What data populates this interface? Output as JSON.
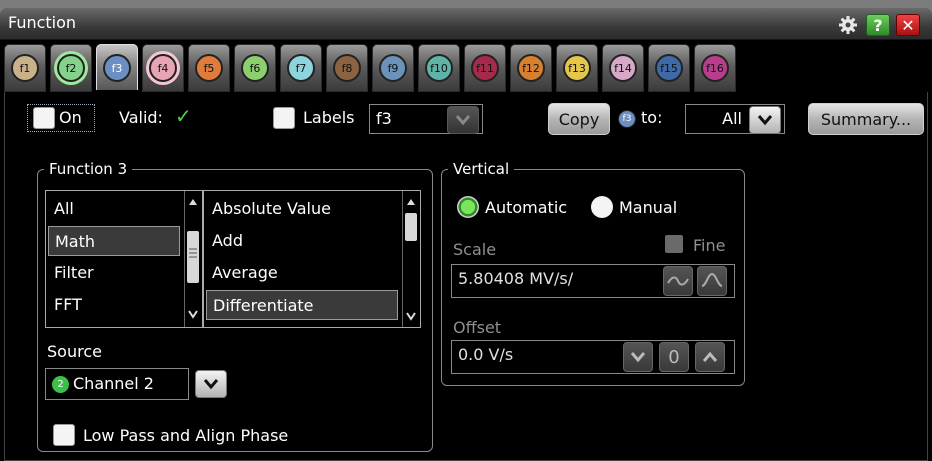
{
  "window": {
    "title": "Function"
  },
  "tabs": [
    {
      "label": "f1",
      "color": "#c9b28a"
    },
    {
      "label": "f2",
      "color": "#83d38c"
    },
    {
      "label": "f3",
      "color": "#6b8fc2"
    },
    {
      "label": "f4",
      "color": "#e8a3b4"
    },
    {
      "label": "f5",
      "color": "#e07b3c"
    },
    {
      "label": "f6",
      "color": "#8ccf6e"
    },
    {
      "label": "f7",
      "color": "#8ed4dd"
    },
    {
      "label": "f8",
      "color": "#8a6440"
    },
    {
      "label": "f9",
      "color": "#6b93b9"
    },
    {
      "label": "f10",
      "color": "#5fb3a7"
    },
    {
      "label": "f11",
      "color": "#a82a4a"
    },
    {
      "label": "f12",
      "color": "#d9802f"
    },
    {
      "label": "f13",
      "color": "#e3c64a"
    },
    {
      "label": "f14",
      "color": "#d8a8c9"
    },
    {
      "label": "f15",
      "color": "#3e6ba8"
    },
    {
      "label": "f16",
      "color": "#b83d8b"
    }
  ],
  "header": {
    "on_label": "On",
    "valid_label": "Valid:",
    "labels_label": "Labels",
    "labels_value": "f3",
    "copy_label": "Copy",
    "copy_badge": "f3",
    "to_label": "to:",
    "to_value": "All",
    "summary_label": "Summary..."
  },
  "function_group": {
    "legend": "Function 3",
    "categories": [
      "All",
      "Math",
      "Filter",
      "FFT"
    ],
    "selected_category": "Math",
    "operators": [
      "Absolute Value",
      "Add",
      "Average",
      "Differentiate"
    ],
    "selected_operator": "Differentiate"
  },
  "source": {
    "label": "Source",
    "badge": "2",
    "value": "Channel 2"
  },
  "lowpass": {
    "label": "Low Pass and Align Phase"
  },
  "vertical": {
    "legend": "Vertical",
    "automatic_label": "Automatic",
    "manual_label": "Manual",
    "scale_label": "Scale",
    "fine_label": "Fine",
    "scale_value": "5.80408 MV/s/",
    "offset_label": "Offset",
    "offset_value": "0.0 V/s",
    "offset_zero": "0"
  }
}
